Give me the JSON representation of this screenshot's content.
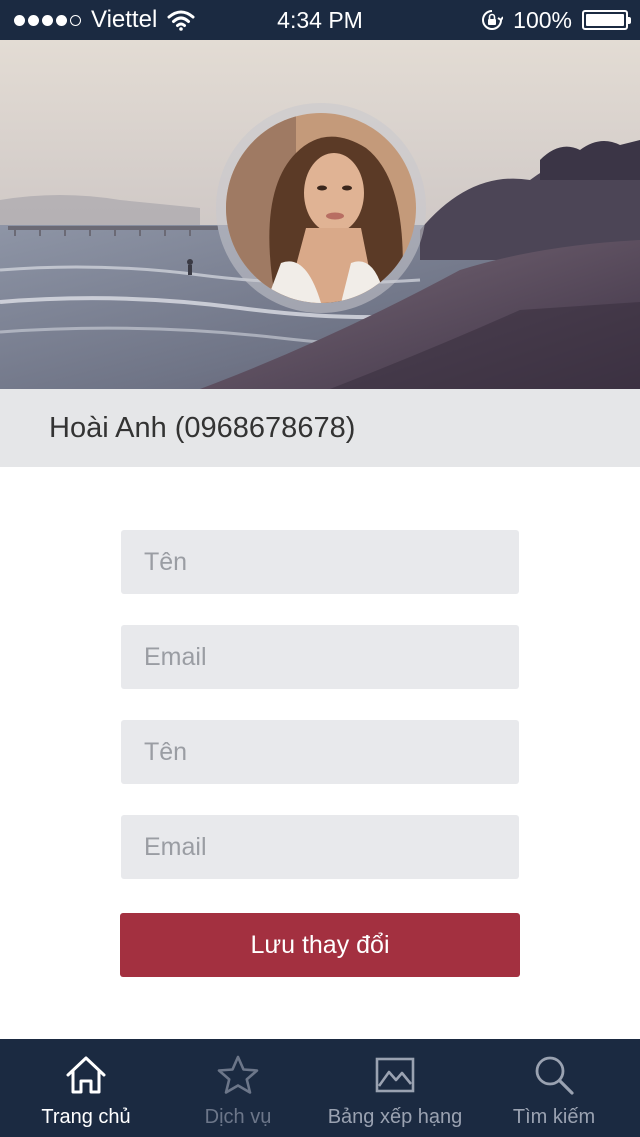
{
  "status_bar": {
    "carrier": "Viettel",
    "time": "4:34 PM",
    "battery": "100%",
    "signal_bars_filled": 4,
    "signal_bars_total": 5
  },
  "profile": {
    "display_name": "Hoài Anh (0968678678)"
  },
  "form": {
    "fields": [
      {
        "placeholder": "Tên",
        "value": ""
      },
      {
        "placeholder": "Email",
        "value": ""
      },
      {
        "placeholder": "Tên",
        "value": ""
      },
      {
        "placeholder": "Email",
        "value": ""
      }
    ],
    "save_label": "Lưu thay đổi"
  },
  "tabs": [
    {
      "label": "Trang chủ",
      "icon": "home-icon",
      "active": true
    },
    {
      "label": "Dịch vụ",
      "icon": "star-icon",
      "active": false
    },
    {
      "label": "Bảng xếp hạng",
      "icon": "image-chart-icon",
      "active": false
    },
    {
      "label": "Tìm kiếm",
      "icon": "search-icon",
      "active": false
    }
  ],
  "colors": {
    "nav_background": "#1b2a41",
    "accent": "#a33040",
    "field_background": "#e8e9ec",
    "name_bar_background": "#e5e6e8"
  }
}
